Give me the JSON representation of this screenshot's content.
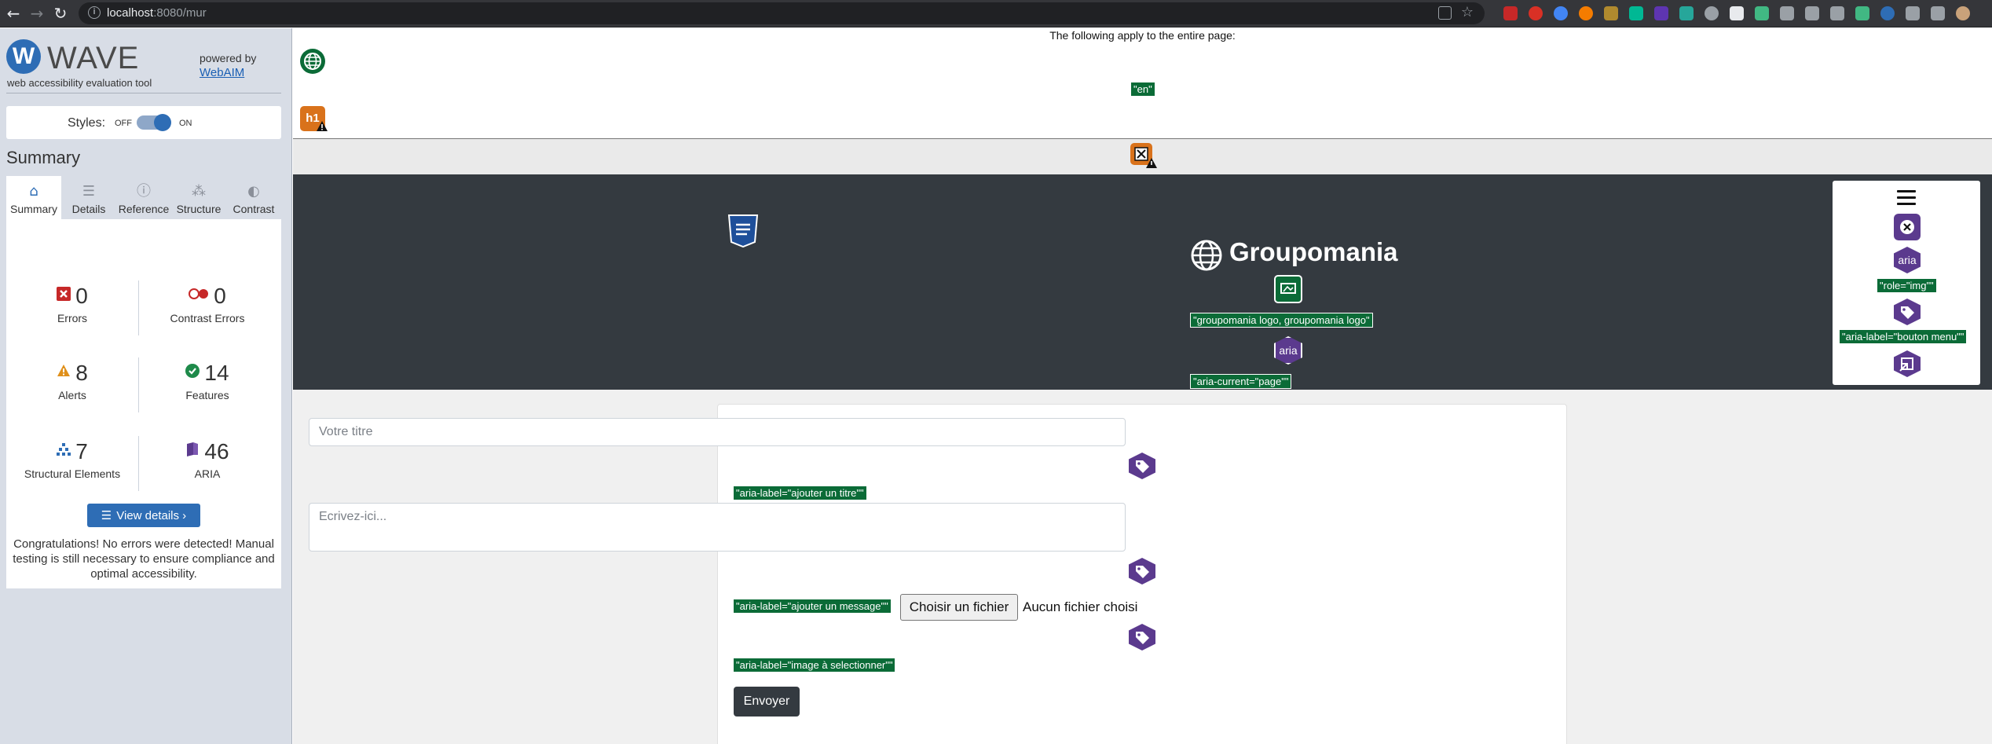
{
  "browser": {
    "url_host": "localhost",
    "url_path": ":8080/mur",
    "nav": {
      "back": "←",
      "forward": "→",
      "reload": "↻"
    },
    "star_icon": "☆"
  },
  "wave": {
    "logo_letter": "W",
    "logo_text": "WAVE",
    "tagline": "web accessibility evaluation tool",
    "powered_by": "powered by",
    "webaim_link": "WebAIM",
    "styles_label": "Styles:",
    "styles_off": "OFF",
    "styles_on": "ON",
    "summary_heading": "Summary",
    "tabs": [
      {
        "label": "Summary",
        "icon": "⌂"
      },
      {
        "label": "Details",
        "icon": "☰"
      },
      {
        "label": "Reference",
        "icon": "ⓘ"
      },
      {
        "label": "Structure",
        "icon": "⁂"
      },
      {
        "label": "Contrast",
        "icon": "◐"
      }
    ],
    "stats": {
      "errors": {
        "count": "0",
        "label": "Errors"
      },
      "contrast": {
        "count": "0",
        "label": "Contrast Errors"
      },
      "alerts": {
        "count": "8",
        "label": "Alerts"
      },
      "features": {
        "count": "14",
        "label": "Features"
      },
      "structural": {
        "count": "7",
        "label": "Structural Elements"
      },
      "aria": {
        "count": "46",
        "label": "ARIA"
      }
    },
    "view_details": "View details ›",
    "congrats": "Congratulations! No errors were detected! Manual testing is still necessary to ensure compliance and optimal accessibility."
  },
  "page": {
    "applies_text": "The following apply to the entire page:",
    "lang_ann": "\"en\"",
    "h1_icon_text": "h1",
    "aria_icon_text": "aria",
    "brand": "Groupomania",
    "logo_alt_ann": "\"groupomania logo, groupomania logo\"",
    "aria_current_ann": "\"aria-current=\"page\"\"",
    "role_img_ann": "\"role=\"img\"\"",
    "aria_label_menu_ann": "\"aria-label=\"bouton menu\"\"",
    "title_placeholder": "Votre titre",
    "aria_label_title_ann": "\"aria-label=\"ajouter un titre\"\"",
    "message_placeholder": "Ecrivez-ici...",
    "aria_label_message_ann": "\"aria-label=\"ajouter un message\"\"",
    "file_button": "Choisir un fichier",
    "file_status": "Aucun fichier choisi",
    "aria_label_image_ann": "\"aria-label=\"image à selectionner\"\"",
    "submit": "Envoyer"
  },
  "colors": {
    "wave_blue": "#2e6db5",
    "feature_green": "#0b6b37",
    "aria_purple": "#5b3a8e",
    "alert_orange": "#d9721b",
    "navbar_dark": "#343a40"
  }
}
